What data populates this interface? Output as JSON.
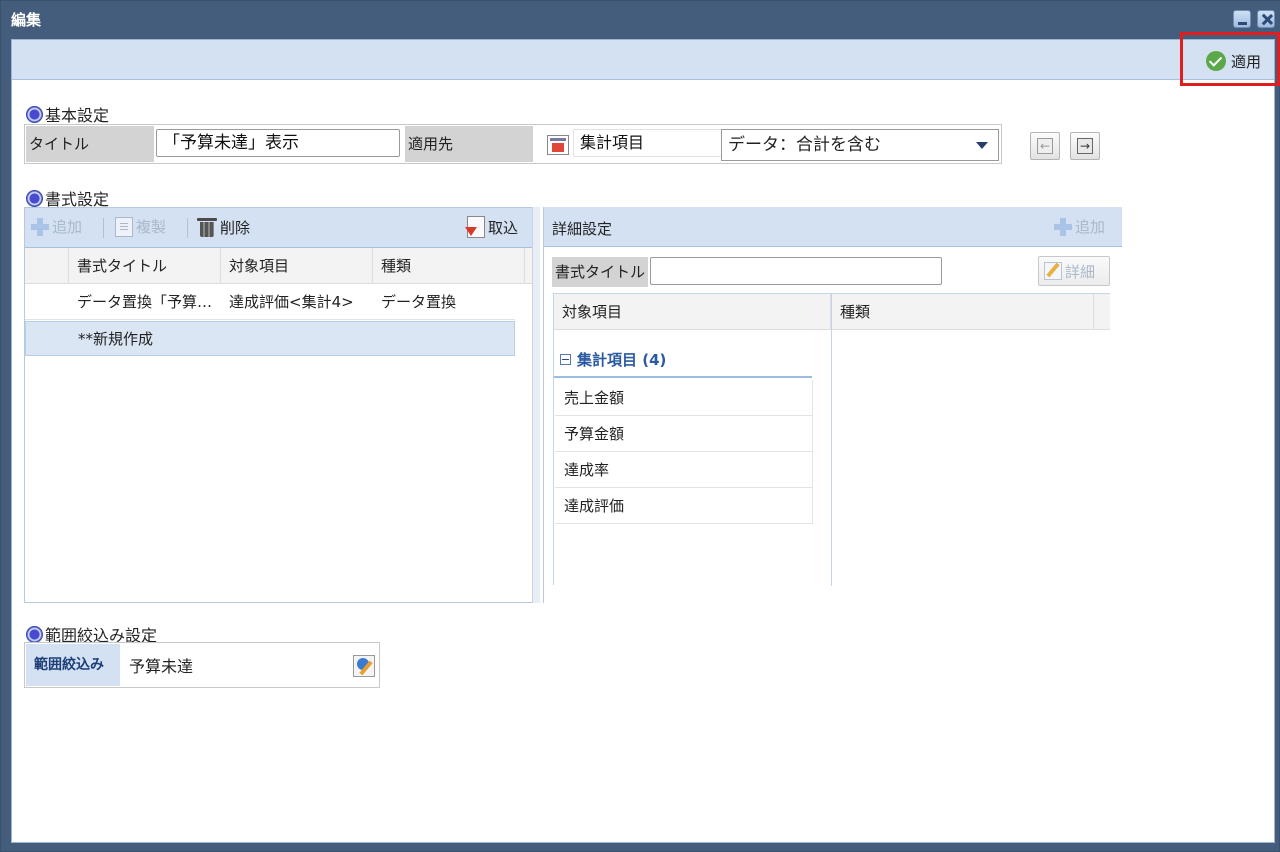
{
  "window": {
    "title": "編集"
  },
  "toolbar": {
    "apply_label": "適用"
  },
  "basic": {
    "section_title": "基本設定",
    "title_label": "タイトル",
    "title_value": "「予算未達」表示",
    "target_label": "適用先",
    "agg_label": "集計項目",
    "data_select": "データ：合計を含む"
  },
  "format": {
    "section_title": "書式設定",
    "toolbar": {
      "add": "追加",
      "copy": "複製",
      "delete": "削除",
      "import": "取込"
    },
    "columns": [
      "書式タイトル",
      "対象項目",
      "種類"
    ],
    "rows": [
      {
        "title": "データ置換「予算未達」",
        "target": "達成評価<集計4>",
        "type": "データ置換"
      },
      {
        "title": "**新規作成",
        "target": "",
        "type": ""
      }
    ]
  },
  "detail": {
    "header": "詳細設定",
    "add": "追加",
    "fmt_title_label": "書式タイトル",
    "fmt_title_value": "",
    "detail_button": "詳細",
    "columns": [
      "対象項目",
      "種類"
    ],
    "group_label": "集計項目 (4)",
    "items": [
      "売上金額",
      "予算金額",
      "達成率",
      "達成評価"
    ]
  },
  "filter": {
    "section_title": "範囲絞込み設定",
    "label": "範囲絞込み",
    "value": "予算未達"
  },
  "colors": {
    "titlebar": "#445d7c",
    "panel": "#d4e1f2",
    "highlight": "#e01e1e",
    "apply": "#5aa84a"
  }
}
